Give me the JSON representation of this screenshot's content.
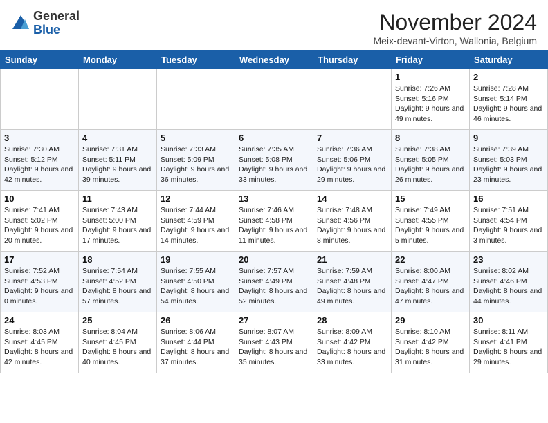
{
  "logo": {
    "general": "General",
    "blue": "Blue"
  },
  "header": {
    "month_title": "November 2024",
    "subtitle": "Meix-devant-Virton, Wallonia, Belgium"
  },
  "days_of_week": [
    "Sunday",
    "Monday",
    "Tuesday",
    "Wednesday",
    "Thursday",
    "Friday",
    "Saturday"
  ],
  "weeks": [
    [
      {
        "day": "",
        "info": ""
      },
      {
        "day": "",
        "info": ""
      },
      {
        "day": "",
        "info": ""
      },
      {
        "day": "",
        "info": ""
      },
      {
        "day": "",
        "info": ""
      },
      {
        "day": "1",
        "info": "Sunrise: 7:26 AM\nSunset: 5:16 PM\nDaylight: 9 hours and 49 minutes."
      },
      {
        "day": "2",
        "info": "Sunrise: 7:28 AM\nSunset: 5:14 PM\nDaylight: 9 hours and 46 minutes."
      }
    ],
    [
      {
        "day": "3",
        "info": "Sunrise: 7:30 AM\nSunset: 5:12 PM\nDaylight: 9 hours and 42 minutes."
      },
      {
        "day": "4",
        "info": "Sunrise: 7:31 AM\nSunset: 5:11 PM\nDaylight: 9 hours and 39 minutes."
      },
      {
        "day": "5",
        "info": "Sunrise: 7:33 AM\nSunset: 5:09 PM\nDaylight: 9 hours and 36 minutes."
      },
      {
        "day": "6",
        "info": "Sunrise: 7:35 AM\nSunset: 5:08 PM\nDaylight: 9 hours and 33 minutes."
      },
      {
        "day": "7",
        "info": "Sunrise: 7:36 AM\nSunset: 5:06 PM\nDaylight: 9 hours and 29 minutes."
      },
      {
        "day": "8",
        "info": "Sunrise: 7:38 AM\nSunset: 5:05 PM\nDaylight: 9 hours and 26 minutes."
      },
      {
        "day": "9",
        "info": "Sunrise: 7:39 AM\nSunset: 5:03 PM\nDaylight: 9 hours and 23 minutes."
      }
    ],
    [
      {
        "day": "10",
        "info": "Sunrise: 7:41 AM\nSunset: 5:02 PM\nDaylight: 9 hours and 20 minutes."
      },
      {
        "day": "11",
        "info": "Sunrise: 7:43 AM\nSunset: 5:00 PM\nDaylight: 9 hours and 17 minutes."
      },
      {
        "day": "12",
        "info": "Sunrise: 7:44 AM\nSunset: 4:59 PM\nDaylight: 9 hours and 14 minutes."
      },
      {
        "day": "13",
        "info": "Sunrise: 7:46 AM\nSunset: 4:58 PM\nDaylight: 9 hours and 11 minutes."
      },
      {
        "day": "14",
        "info": "Sunrise: 7:48 AM\nSunset: 4:56 PM\nDaylight: 9 hours and 8 minutes."
      },
      {
        "day": "15",
        "info": "Sunrise: 7:49 AM\nSunset: 4:55 PM\nDaylight: 9 hours and 5 minutes."
      },
      {
        "day": "16",
        "info": "Sunrise: 7:51 AM\nSunset: 4:54 PM\nDaylight: 9 hours and 3 minutes."
      }
    ],
    [
      {
        "day": "17",
        "info": "Sunrise: 7:52 AM\nSunset: 4:53 PM\nDaylight: 9 hours and 0 minutes."
      },
      {
        "day": "18",
        "info": "Sunrise: 7:54 AM\nSunset: 4:52 PM\nDaylight: 8 hours and 57 minutes."
      },
      {
        "day": "19",
        "info": "Sunrise: 7:55 AM\nSunset: 4:50 PM\nDaylight: 8 hours and 54 minutes."
      },
      {
        "day": "20",
        "info": "Sunrise: 7:57 AM\nSunset: 4:49 PM\nDaylight: 8 hours and 52 minutes."
      },
      {
        "day": "21",
        "info": "Sunrise: 7:59 AM\nSunset: 4:48 PM\nDaylight: 8 hours and 49 minutes."
      },
      {
        "day": "22",
        "info": "Sunrise: 8:00 AM\nSunset: 4:47 PM\nDaylight: 8 hours and 47 minutes."
      },
      {
        "day": "23",
        "info": "Sunrise: 8:02 AM\nSunset: 4:46 PM\nDaylight: 8 hours and 44 minutes."
      }
    ],
    [
      {
        "day": "24",
        "info": "Sunrise: 8:03 AM\nSunset: 4:45 PM\nDaylight: 8 hours and 42 minutes."
      },
      {
        "day": "25",
        "info": "Sunrise: 8:04 AM\nSunset: 4:45 PM\nDaylight: 8 hours and 40 minutes."
      },
      {
        "day": "26",
        "info": "Sunrise: 8:06 AM\nSunset: 4:44 PM\nDaylight: 8 hours and 37 minutes."
      },
      {
        "day": "27",
        "info": "Sunrise: 8:07 AM\nSunset: 4:43 PM\nDaylight: 8 hours and 35 minutes."
      },
      {
        "day": "28",
        "info": "Sunrise: 8:09 AM\nSunset: 4:42 PM\nDaylight: 8 hours and 33 minutes."
      },
      {
        "day": "29",
        "info": "Sunrise: 8:10 AM\nSunset: 4:42 PM\nDaylight: 8 hours and 31 minutes."
      },
      {
        "day": "30",
        "info": "Sunrise: 8:11 AM\nSunset: 4:41 PM\nDaylight: 8 hours and 29 minutes."
      }
    ]
  ]
}
